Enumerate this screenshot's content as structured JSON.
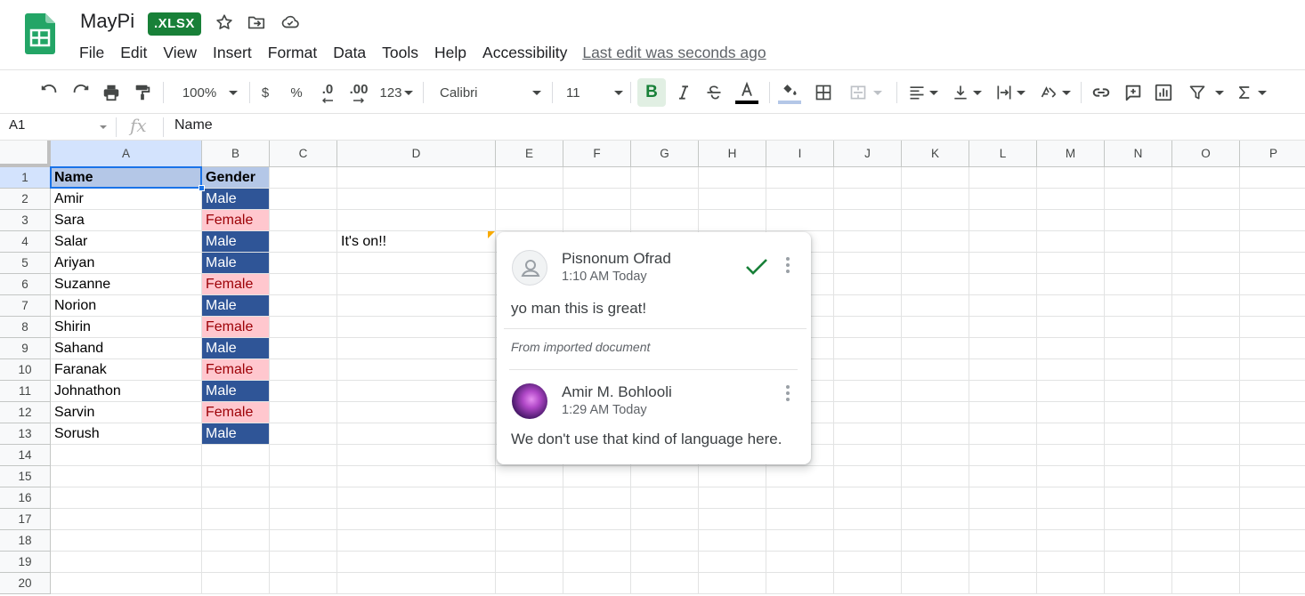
{
  "app": {
    "doc_title": "MayPi",
    "badge": ".XLSX",
    "brand_color": "#188038",
    "icons": [
      "star-icon",
      "move-to-folder-icon",
      "cloud-status-icon"
    ]
  },
  "menu": {
    "items": [
      "File",
      "Edit",
      "View",
      "Insert",
      "Format",
      "Data",
      "Tools",
      "Help",
      "Accessibility"
    ],
    "last_edit": "Last edit was seconds ago"
  },
  "toolbar": {
    "zoom": "100%",
    "currency": "$",
    "percent": "%",
    "decrease_decimals": ".0",
    "increase_decimals": ".00",
    "more_formats": "123",
    "font": "Calibri",
    "font_size": "11",
    "bold": "B"
  },
  "formula_bar": {
    "name_box": "A1",
    "fx": "fx",
    "value": "Name"
  },
  "grid": {
    "columns": [
      "A",
      "B",
      "C",
      "D",
      "E",
      "F",
      "G",
      "H",
      "I",
      "J",
      "K",
      "L",
      "M",
      "N",
      "O",
      "P"
    ],
    "rows": [
      "1",
      "2",
      "3",
      "4",
      "5",
      "6",
      "7",
      "8",
      "9",
      "10",
      "11",
      "12",
      "13",
      "14",
      "15",
      "16",
      "17",
      "18",
      "19",
      "20"
    ],
    "header": {
      "name": "Name",
      "gender": "Gender"
    },
    "people": [
      {
        "name": "Amir",
        "gender": "Male"
      },
      {
        "name": "Sara",
        "gender": "Female"
      },
      {
        "name": "Salar",
        "gender": "Male"
      },
      {
        "name": "Ariyan",
        "gender": "Male"
      },
      {
        "name": "Suzanne",
        "gender": "Female"
      },
      {
        "name": "Norion",
        "gender": "Male"
      },
      {
        "name": "Shirin",
        "gender": "Female"
      },
      {
        "name": "Sahand",
        "gender": "Male"
      },
      {
        "name": "Faranak",
        "gender": "Female"
      },
      {
        "name": "Johnathon",
        "gender": "Male"
      },
      {
        "name": "Sarvin",
        "gender": "Female"
      },
      {
        "name": "Sorush",
        "gender": "Male"
      }
    ],
    "d4": "It's on!!",
    "colors": {
      "header_fill": "#b4c7e7",
      "male_fill": "#2f5597",
      "female_fill": "#ffc7ce",
      "female_text": "#9c0006"
    }
  },
  "comments": {
    "first": {
      "author": "Pisnonum Ofrad",
      "time": "1:10 AM Today",
      "body": "yo man this is great!",
      "note": "From imported document"
    },
    "reply": {
      "author": "Amir M. Bohlooli",
      "time": "1:29 AM Today",
      "body": "We don't use that kind of language here."
    }
  }
}
